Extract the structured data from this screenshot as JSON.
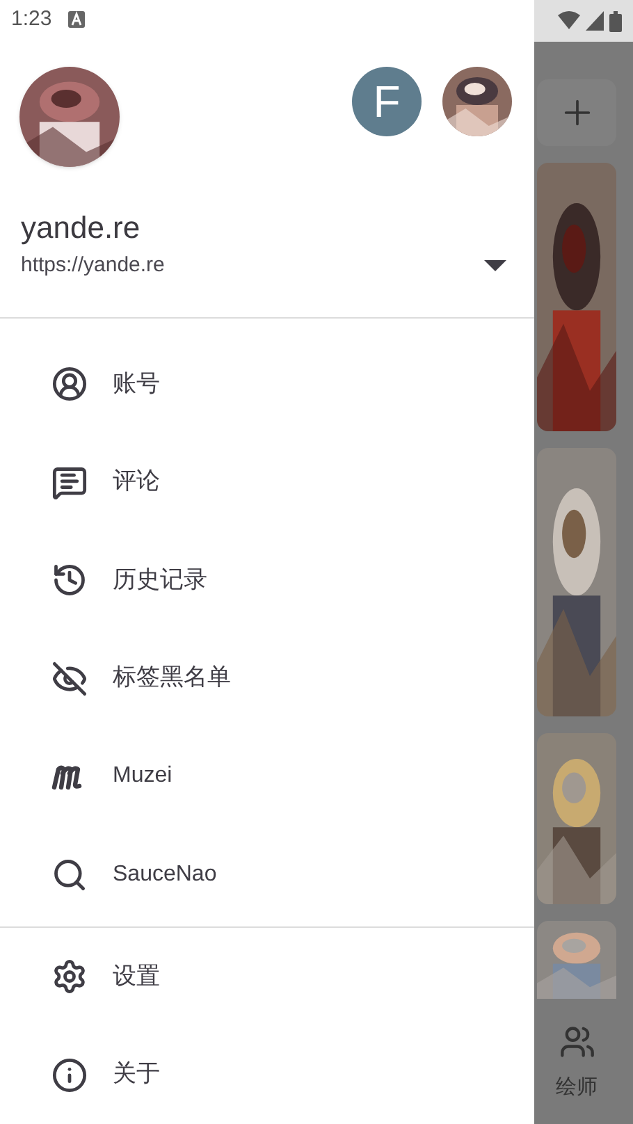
{
  "status_bar": {
    "time": "1:23"
  },
  "header": {
    "account_letter": "F",
    "site_title": "yande.re",
    "site_url": "https://yande.re"
  },
  "menu": [
    {
      "kind": "account",
      "label": "账号"
    },
    {
      "kind": "comment",
      "label": "评论"
    },
    {
      "kind": "history",
      "label": "历史记录"
    },
    {
      "kind": "hidden",
      "label": "标签黑名单"
    },
    {
      "kind": "muzei",
      "label": "Muzei"
    },
    {
      "kind": "search",
      "label": "SauceNao"
    }
  ],
  "footer_menu": [
    {
      "kind": "settings",
      "label": "设置"
    },
    {
      "kind": "info",
      "label": "关于"
    }
  ],
  "background": {
    "bottom_nav_label": "绘师"
  }
}
